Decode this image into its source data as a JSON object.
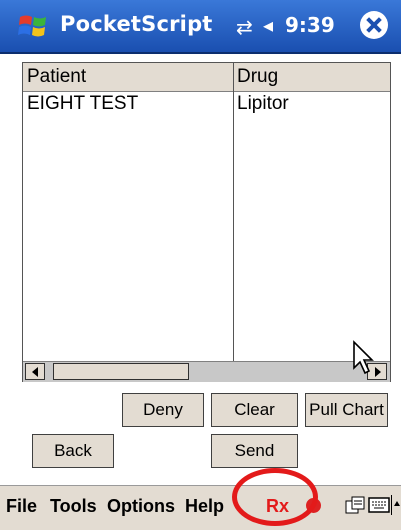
{
  "title_bar": {
    "app_name": "PocketScript",
    "time": "9:39",
    "connectivity_glyph": "⇄",
    "volume_glyph": "◂"
  },
  "list": {
    "columns": [
      "Patient",
      "Drug"
    ],
    "rows": [
      {
        "patient": "EIGHT TEST",
        "drug": "Lipitor"
      }
    ]
  },
  "buttons": {
    "deny": "Deny",
    "clear": "Clear",
    "pull_chart": "Pull Chart",
    "back": "Back",
    "send": "Send"
  },
  "menu": {
    "file": "File",
    "tools": "Tools",
    "options": "Options",
    "help": "Help",
    "rx": "Rx"
  },
  "colors": {
    "title_blue": "#1a4fb0",
    "highlight_red": "#e31a1a",
    "button_face": "#e3dcd2"
  }
}
